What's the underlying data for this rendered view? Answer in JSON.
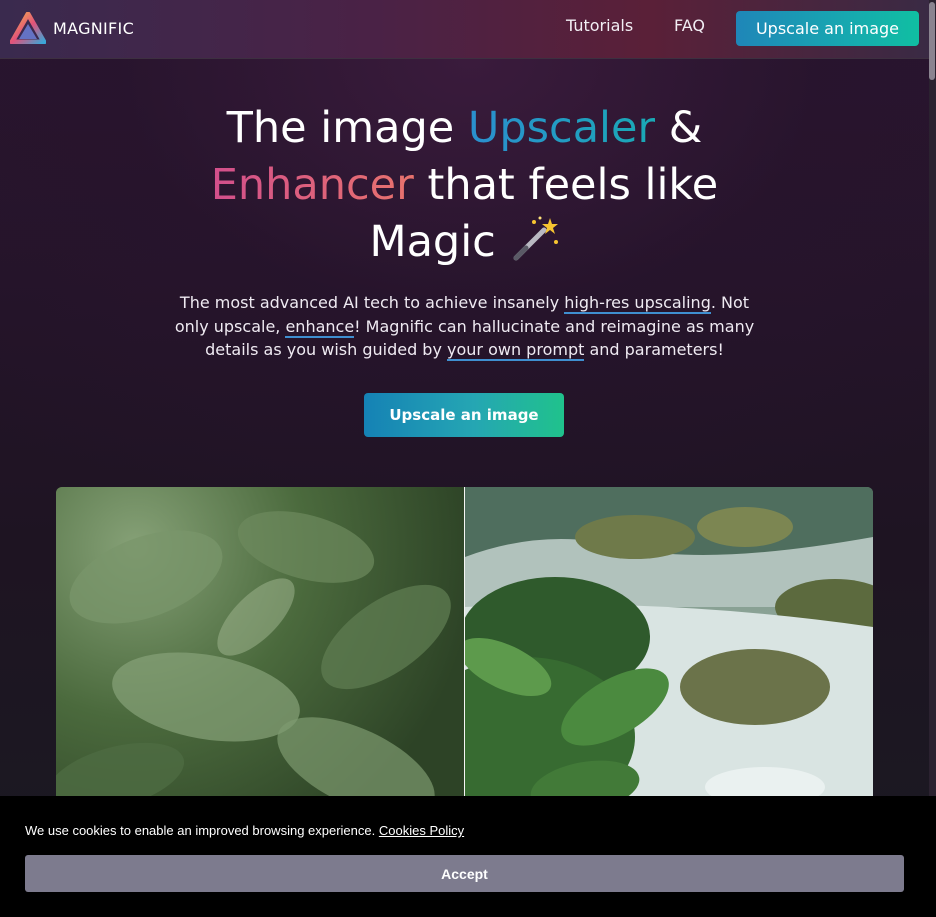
{
  "header": {
    "brand": "MAGNIFIC",
    "nav": {
      "tutorials": "Tutorials",
      "faq": "FAQ",
      "cta": "Upscale an image"
    }
  },
  "hero": {
    "title": {
      "part1": "The image ",
      "highlight1": "Upscaler",
      "part2": " & ",
      "highlight2": "Enhancer",
      "part3": " that feels like ",
      "part4": "Magic "
    },
    "subtitle": {
      "t1": "The most advanced AI tech to achieve insanely ",
      "link1": "high-res upscaling",
      "t2": ". Not only upscale, ",
      "link2": "enhance",
      "t3": "! Magnific can hallucinate and reimagine as many details as you wish guided by ",
      "link3": "your own prompt",
      "t4": " and parameters!"
    },
    "cta": "Upscale an image"
  },
  "comparison": {
    "before_icon": "blurry-foliage-photo",
    "after_icon": "upscaled-river-foliage-photo"
  },
  "cookie_banner": {
    "text": "We use cookies to enable an improved browsing experience. ",
    "policy_link": "Cookies Policy",
    "accept": "Accept"
  },
  "colors": {
    "accent_blue": "#1f86b8",
    "accent_teal": "#10bfa2",
    "accent_pink": "#d24f8c",
    "accept_button": "#7d7b8e"
  }
}
